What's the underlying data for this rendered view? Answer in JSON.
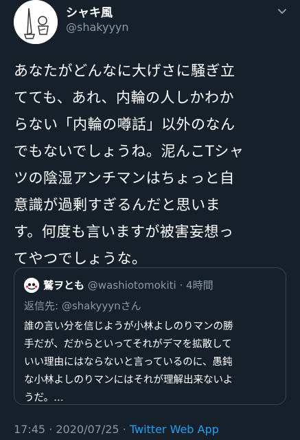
{
  "author": {
    "name": "シャキ風",
    "handle": "@shakyyyn"
  },
  "tweet": {
    "lines": [
      "あなたがどんなに大げさに騒ぎ立",
      "てても、あれ、内輪の人しかわか",
      "らない「内輪の噂話」以外のなん",
      "でもないでしょうね。泥んこTシャ",
      "ツの陰湿アンチマンはちょっと自",
      "意識が過剰すぎるんだと思いま",
      "す。何度も言いますが被害妄想っ",
      "てやつでしょうな。"
    ]
  },
  "quoted": {
    "name": "鷲ヲとも",
    "handle": "@washiotomokiti",
    "separator": "·",
    "time": "4時間",
    "reply_prefix": "返信先: ",
    "reply_to": "@shakyyynさん",
    "lines": [
      "誰の言い分を信じようが小林よしのりマンの勝",
      "手だが、だからといってそれがデマを拡散して",
      "いい理由にはならないと言っているのに、愚鈍",
      "な小林よしのりマンにはそれが理解出来ないよ",
      "うだ。…"
    ]
  },
  "footer": {
    "time": "17:45",
    "separator1": " · ",
    "date": "2020/07/25",
    "separator2": " · ",
    "source": "Twitter Web App"
  },
  "icons": {
    "caret": "chevron-down-icon"
  }
}
